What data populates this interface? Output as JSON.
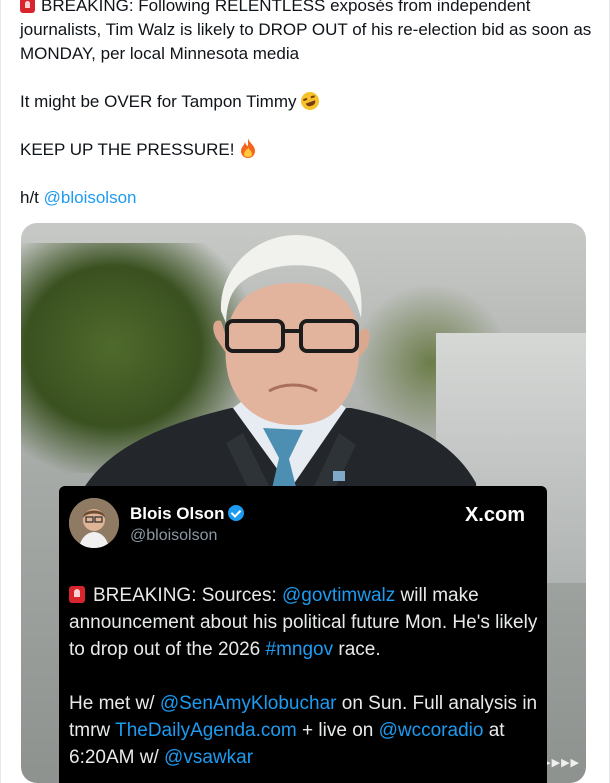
{
  "post": {
    "line1": "BREAKING: Following RELENTLESS exposés from independent journalists, Tim Walz is likely to DROP OUT of his re-election bid as soon as MONDAY, per local Minnesota media",
    "line2": "It might be OVER for Tampon Timmy",
    "line3": "KEEP UP THE PRESSURE!",
    "ht_prefix": "h/t ",
    "ht_handle": "@bloisolson"
  },
  "embedded_card": {
    "name": "Blois Olson",
    "handle": "@bloisolson",
    "source": "X.com",
    "body1": {
      "prefix": "BREAKING:  Sources: ",
      "mention": "@govtimwalz",
      "mid": " will make announcement about his political future Mon.  He's likely to drop out of the 2026 ",
      "hashtag": "#mngov",
      "suffix": " race."
    },
    "body2": {
      "prefix": "He met w/ ",
      "mention1": "@SenAmyKlobuchar",
      "mid1": "  on Sun.  Full analysis in tmrw ",
      "link": "TheDailyAgenda.com",
      "mid2": "  + live on ",
      "mention2": "@wccoradio",
      "mid3": " at 6:20AM w/ ",
      "mention3": "@vsawkar"
    }
  },
  "watermark": "▶▶▶▶▶▶▶▶▶▶",
  "colors": {
    "link": "#1d9bf0",
    "text": "#0f1419",
    "card_bg": "#000000"
  },
  "icons": [
    "siren-emoji",
    "rolling-laughing-emoji",
    "fire-emoji",
    "verified-badge"
  ]
}
